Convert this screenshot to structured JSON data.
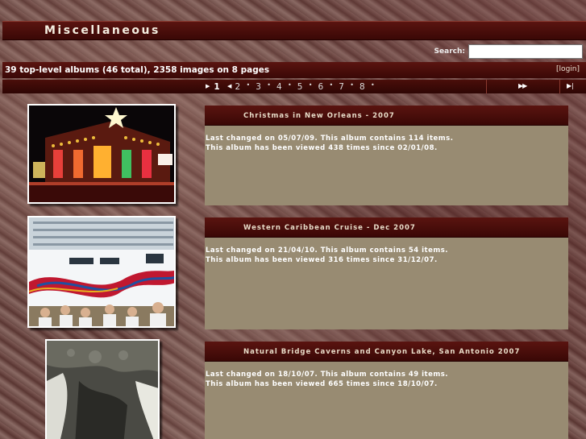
{
  "site": {
    "title": "Miscellaneous"
  },
  "search": {
    "label": "Search:",
    "value": ""
  },
  "stats": {
    "text": "39 top-level albums (46 total), 2358 images on 8 pages",
    "login": "[login]"
  },
  "pager": {
    "current": "1",
    "pages": [
      "2",
      "3",
      "4",
      "5",
      "6",
      "7",
      "8"
    ],
    "next_label": "▶▶",
    "last_label": "▶|"
  },
  "albums": [
    {
      "title": "Christmas in New Orleans - 2007",
      "changed": "Last changed on 05/07/09. This album contains 114 items.",
      "viewed": "This album has been viewed 438 times since 02/01/08."
    },
    {
      "title": "Western Caribbean Cruise - Dec 2007",
      "changed": "Last changed on 21/04/10. This album contains 54 items.",
      "viewed": "This album has been viewed 316 times since 31/12/07."
    },
    {
      "title": "Natural Bridge Caverns and Canyon Lake, San Antonio 2007",
      "changed": "Last changed on 18/10/07. This album contains 49 items.",
      "viewed": "This album has been viewed 665 times since 18/10/07."
    }
  ]
}
